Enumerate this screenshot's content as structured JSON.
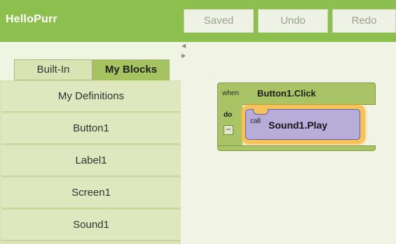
{
  "app": {
    "title": "HelloPurr"
  },
  "toolbar": {
    "saved_label": "Saved",
    "undo_label": "Undo",
    "redo_label": "Redo"
  },
  "tabs": [
    {
      "label": "Built-In",
      "active": false
    },
    {
      "label": "My Blocks",
      "active": true
    }
  ],
  "drawers": [
    {
      "label": "My Definitions"
    },
    {
      "label": "Button1"
    },
    {
      "label": "Label1"
    },
    {
      "label": "Screen1"
    },
    {
      "label": "Sound1"
    }
  ],
  "event_block": {
    "when_label": "when",
    "event_name": "Button1.Click",
    "do_label": "do",
    "collapse_glyph": "−"
  },
  "call_block": {
    "call_label": "call",
    "method_name": "Sound1.Play",
    "selected": true
  },
  "colors": {
    "header": "#8dbf4f",
    "event_block": "#a8c467",
    "call_block": "#b8acd9",
    "selection_glow": "#f6c35a"
  }
}
